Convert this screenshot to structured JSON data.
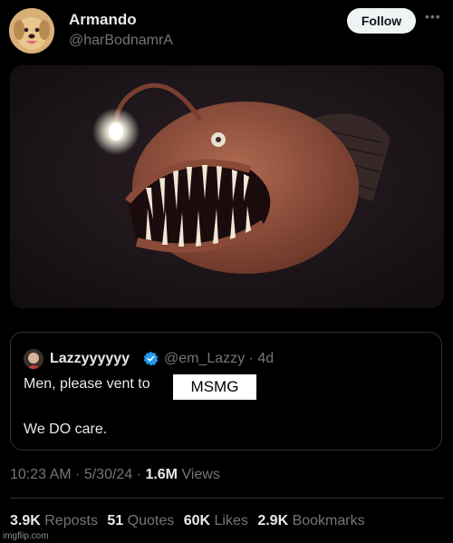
{
  "author": {
    "name": "Armando",
    "handle": "@harBodnamrA",
    "follow_label": "Follow"
  },
  "quoted_post": {
    "name": "Lazzyyyyyy",
    "handle": "@em_Lazzy",
    "age": "4d",
    "text_line1": "Men, please vent to",
    "text_line2": "We DO care."
  },
  "overlay_text": "MSMG",
  "post_meta": {
    "time": "10:23 AM",
    "date": "5/30/24",
    "views_count": "1.6M",
    "views_label": "Views"
  },
  "stats": {
    "reposts_count": "3.9K",
    "reposts_label": "Reposts",
    "quotes_count": "51",
    "quotes_label": "Quotes",
    "likes_count": "60K",
    "likes_label": "Likes",
    "bookmarks_count": "2.9K",
    "bookmarks_label": "Bookmarks"
  },
  "watermark": "imgflip.com",
  "colors": {
    "background": "#000000",
    "text_primary": "#e7e9ea",
    "text_secondary": "#71767b",
    "verified_blue": "#1d9bf0",
    "border": "#2f3336"
  },
  "icons": [
    "more-horizontal-icon",
    "verified-badge-icon"
  ],
  "media": {
    "subject": "anglerfish image"
  }
}
